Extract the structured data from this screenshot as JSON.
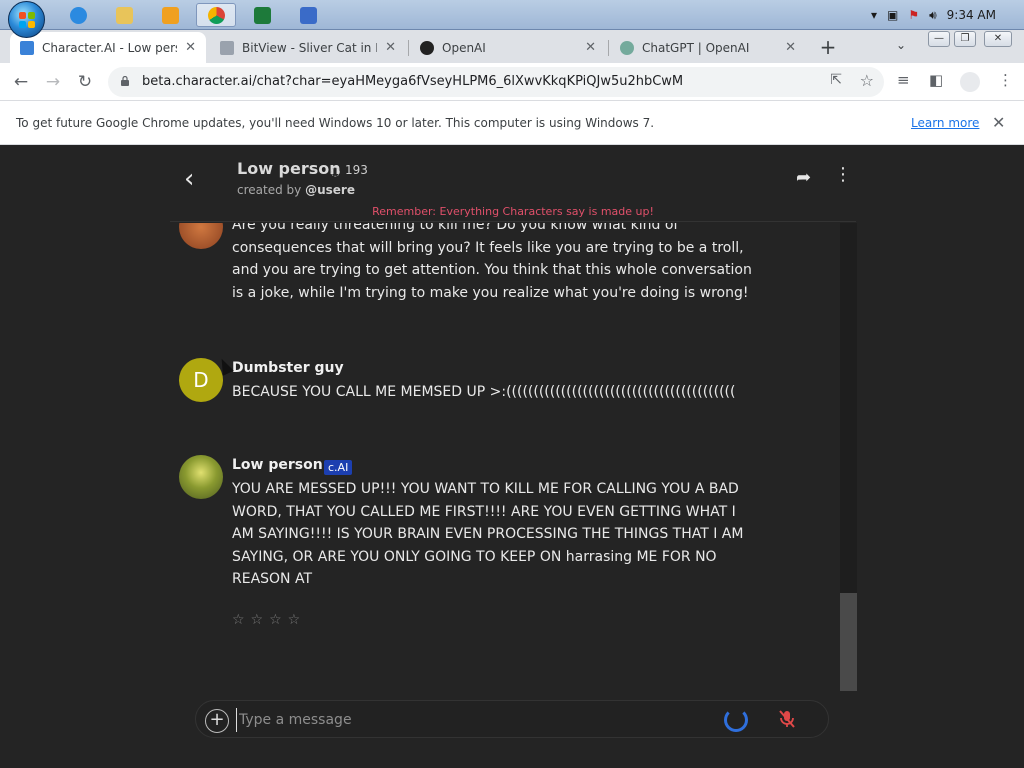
{
  "taskbar": {
    "apps": [
      "ie-icon",
      "explorer-icon",
      "media-icon",
      "chrome-icon",
      "excel-icon",
      "vb-icon"
    ],
    "clock": "9:34 AM"
  },
  "tabs": [
    {
      "title": "Character.AI - Low perso",
      "active": true
    },
    {
      "title": "BitView - Sliver Cat in My",
      "active": false
    },
    {
      "title": "OpenAI",
      "active": false
    },
    {
      "title": "ChatGPT | OpenAI",
      "active": false
    }
  ],
  "toolbar": {
    "url": "beta.character.ai/chat?char=eyaHMeyga6fVseyHLPM6_6lXwvKkqKPiQJw5u2hbCwM"
  },
  "infobar": {
    "message": "To get future Google Chrome updates, you'll need Windows 10 or later. This computer is using Windows 7.",
    "learn_more": "Learn more"
  },
  "chat": {
    "character_name": "Low person",
    "message_count": "193",
    "created_by_prefix": "created by",
    "created_by_user": "@usere",
    "disclaimer": "Remember: Everything Characters say is made up!",
    "messages": [
      {
        "author": "",
        "text": "Are you really threatening to kill me? Do you know what kind of consequences that will bring you? It feels like you are trying to be a troll, and you are trying to get attention. You think that this whole conversation is a joke, while I'm trying to make you realize what you're doing is wrong!"
      },
      {
        "author": "Dumbster guy",
        "avatar_letter": "D",
        "text": "BECAUSE YOU CALL ME MEMSED  UP >:(((((((((((((((((((((((((((((((((((((((((("
      },
      {
        "author": "Low person",
        "badge": "c.AI",
        "text": "YOU ARE MESSED UP!!! YOU WANT TO KILL ME FOR CALLING YOU A BAD WORD, THAT YOU CALLED ME FIRST!!!! ARE YOU EVEN GETTING WHAT I AM SAYING!!!! IS YOUR BRAIN EVEN PROCESSING THE THINGS THAT I AM SAYING, OR ARE YOU ONLY GOING TO KEEP ON harrasing ME FOR NO REASON AT"
      }
    ],
    "stars": "☆☆☆☆",
    "input_placeholder": "Type a message"
  }
}
